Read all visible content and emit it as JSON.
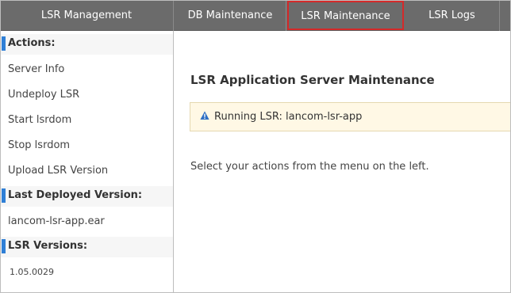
{
  "topbar": {
    "brand": "LSR Management",
    "tabs": [
      {
        "label": "DB Maintenance"
      },
      {
        "label": "LSR Maintenance",
        "active": true
      },
      {
        "label": "LSR Logs"
      }
    ],
    "active_outline_color": "#d42a2a"
  },
  "sidebar": {
    "actions_title": "Actions:",
    "actions": [
      {
        "label": "Server Info"
      },
      {
        "label": "Undeploy LSR"
      },
      {
        "label": "Start lsrdom"
      },
      {
        "label": "Stop lsrdom"
      },
      {
        "label": "Upload LSR Version"
      }
    ],
    "last_deployed_title": "Last Deployed Version:",
    "last_deployed_value": "lancom-lsr-app.ear",
    "versions_title": "LSR Versions:",
    "versions": [
      "1.05.0029"
    ],
    "section_accent": "#2f7fd6"
  },
  "main": {
    "title": "LSR Application Server Maintenance",
    "alert": {
      "icon": "warning-icon",
      "text": "Running LSR: lancom-lsr-app"
    },
    "hint": "Select your actions from the menu on the left."
  }
}
